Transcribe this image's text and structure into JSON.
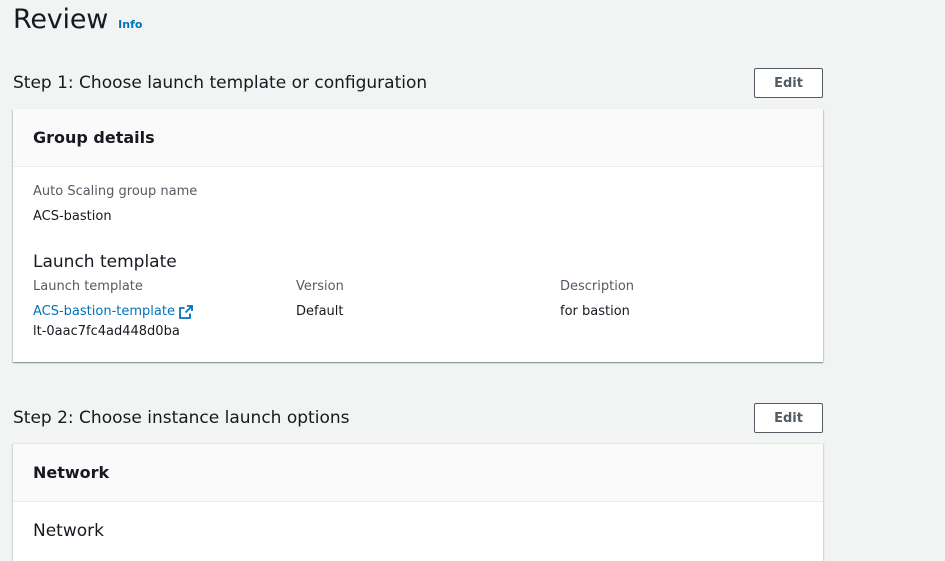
{
  "page": {
    "title": "Review",
    "info_label": "Info"
  },
  "step1": {
    "title": "Step 1: Choose launch template or configuration",
    "edit_label": "Edit",
    "card_title": "Group details",
    "group_name_label": "Auto Scaling group name",
    "group_name_value": "ACS-bastion",
    "launch_template_heading": "Launch template",
    "columns": {
      "template_label": "Launch template",
      "template_link": "ACS-bastion-template",
      "template_id": "lt-0aac7fc4ad448d0ba",
      "version_label": "Version",
      "version_value": "Default",
      "description_label": "Description",
      "description_value": "for bastion"
    }
  },
  "step2": {
    "title": "Step 2: Choose instance launch options",
    "edit_label": "Edit",
    "card_title": "Network",
    "network_heading": "Network"
  },
  "icons": {
    "external_link": "external-link-icon"
  },
  "colors": {
    "link": "#0073bb",
    "background": "#f2f3f3",
    "text": "#16191f",
    "label": "#545b64"
  }
}
